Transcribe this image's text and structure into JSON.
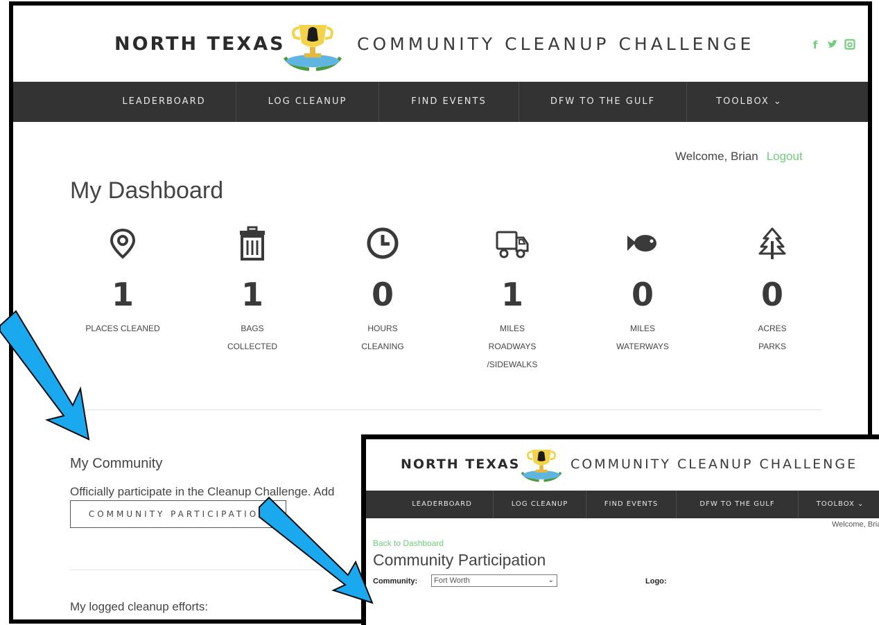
{
  "site": {
    "brand_bold": "NORTH TEXAS",
    "brand_light": "COMMUNITY CLEANUP CHALLENGE",
    "social": [
      "f",
      "t",
      "ig"
    ]
  },
  "nav": {
    "items": [
      {
        "label": "LEADERBOARD"
      },
      {
        "label": "LOG CLEANUP"
      },
      {
        "label": "FIND EVENTS"
      },
      {
        "label": "DFW TO THE GULF"
      },
      {
        "label": "TOOLBOX ⌄"
      }
    ]
  },
  "user": {
    "welcome": "Welcome, Brian",
    "logout": "Logout"
  },
  "dashboard": {
    "title": "My Dashboard",
    "stats": [
      {
        "icon": "map-pin-icon",
        "value": "1",
        "label": "PLACES CLEANED"
      },
      {
        "icon": "trash-can-icon",
        "value": "1",
        "label": "BAGS\nCOLLECTED"
      },
      {
        "icon": "clock-icon",
        "value": "0",
        "label": "HOURS\nCLEANING"
      },
      {
        "icon": "truck-icon",
        "value": "1",
        "label": "MILES\nROADWAYS\n/SIDEWALKS"
      },
      {
        "icon": "fish-icon",
        "value": "0",
        "label": "MILES\nWATERWAYS"
      },
      {
        "icon": "tree-icon",
        "value": "0",
        "label": "ACRES\nPARKS"
      }
    ]
  },
  "community": {
    "title": "My Community",
    "text": "Officially participate in the Cleanup Challenge. Add",
    "button": "COMMUNITY PARTICIPATION"
  },
  "efforts": {
    "title": "My logged cleanup efforts:"
  },
  "inset": {
    "brand_bold": "NORTH TEXAS",
    "brand_light": "COMMUNITY CLEANUP CHALLENGE",
    "nav": [
      "LEADERBOARD",
      "LOG CLEANUP",
      "FIND EVENTS",
      "DFW TO THE GULF",
      "TOOLBOX ⌄"
    ],
    "welcome": "Welcome, Brian",
    "back": "Back to Dashboard",
    "title": "Community Participation",
    "community_label": "Community:",
    "community_value": "Fort Worth",
    "logo_label": "Logo:"
  },
  "colors": {
    "accent_green": "#6fce7c",
    "nav_bg": "#333333",
    "arrow_blue": "#1aa9ef"
  }
}
